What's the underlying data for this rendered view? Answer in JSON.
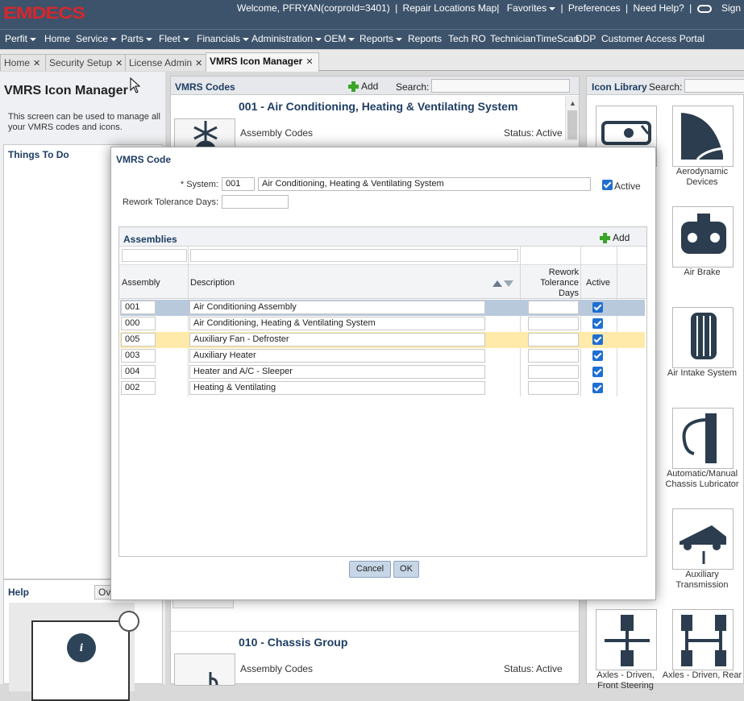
{
  "app": {
    "logo": "EMDECS",
    "welcome": "Welcome, PFRYAN(corproId=3401)",
    "links": [
      "|",
      "Repair Locations Map|",
      "Favorites",
      "|",
      "Preferences",
      "|",
      "Need Help?",
      "|",
      "Sign"
    ]
  },
  "menu": [
    "Perfit",
    "Home",
    "Service",
    "Parts",
    "Fleet",
    "Financials",
    "Administration",
    "OEM",
    "Reports",
    "Reports",
    "Tech RO",
    "TechnicianTimeScan",
    "DDP",
    "Customer Access Portal"
  ],
  "tabs": [
    "Home",
    "Security Setup",
    "License Admin",
    "VMRS Icon Manager"
  ],
  "left": {
    "title": "VMRS Icon Manager",
    "description": "This screen can be used to manage all your VMRS codes and icons.",
    "things_to_do": "Things To Do",
    "help_title": "Help",
    "help_dropdown": "Ov"
  },
  "center": {
    "title": "VMRS Codes",
    "add": "Add",
    "search_label": "Search:",
    "systems": [
      {
        "code_title": "001 - Air Conditioning, Heating & Ventilating System",
        "assembly_label": "Assembly Codes",
        "status": "Status: Active"
      },
      {
        "code_title": "010 - Chassis Group",
        "assembly_label": "Assembly Codes",
        "status": "Status: Active"
      }
    ]
  },
  "library": {
    "title": "Icon Library",
    "search_label": "Search:",
    "icons": [
      {
        "name": "Aerodynamic Devices",
        "caption": "Aerodynamic\nDevices"
      },
      {
        "name": "Air Brake",
        "caption": "Air Brake"
      },
      {
        "name": "Air Intake System",
        "caption": "Air Intake System"
      },
      {
        "name": "Automatic/Manual Chassis Lubricator",
        "caption": "Automatic/Manual\nChassis\nLubricator"
      },
      {
        "name": "Auxiliary Transmission",
        "caption": "Auxiliary\nTransmission"
      },
      {
        "name": "Axles - Driven, Front Steering",
        "caption": "Axles - Driven,\nFront Steering"
      },
      {
        "name": "Axles - Driven, Rear",
        "caption": "Axles - Driven,\nRear"
      }
    ]
  },
  "dialog": {
    "title": "VMRS Code",
    "system_label": "* System:",
    "system_code": "001",
    "system_desc": "Air Conditioning, Heating & Ventilating System",
    "active_label": "Active",
    "active": true,
    "rework_label": "Rework Tolerance Days:",
    "rework_value": "",
    "assemblies": {
      "title": "Assemblies",
      "add": "Add",
      "columns": [
        "Assembly",
        "Description",
        "Rework Tolerance Days",
        "Active"
      ],
      "rows": [
        {
          "assembly": "001",
          "description": "Air Conditioning Assembly",
          "rework": "",
          "active": true,
          "state": "selected"
        },
        {
          "assembly": "000",
          "description": "Air Conditioning, Heating & Ventilating System",
          "rework": "",
          "active": true,
          "state": ""
        },
        {
          "assembly": "005",
          "description": "Auxiliary Fan - Defroster",
          "rework": "",
          "active": true,
          "state": "hover"
        },
        {
          "assembly": "003",
          "description": "Auxiliary Heater",
          "rework": "",
          "active": true,
          "state": ""
        },
        {
          "assembly": "004",
          "description": "Heater and A/C - Sleeper",
          "rework": "",
          "active": true,
          "state": ""
        },
        {
          "assembly": "002",
          "description": "Heating & Ventilating",
          "rework": "",
          "active": true,
          "state": ""
        }
      ]
    },
    "cancel": "Cancel",
    "ok": "OK"
  },
  "colors": {
    "header": "#3d536b",
    "logo": "#d8262b",
    "title": "#1e3d62",
    "selected_row": "#b9c9dc",
    "hover_row": "#ffeaaa",
    "checkbox": "#1f6fcf"
  }
}
